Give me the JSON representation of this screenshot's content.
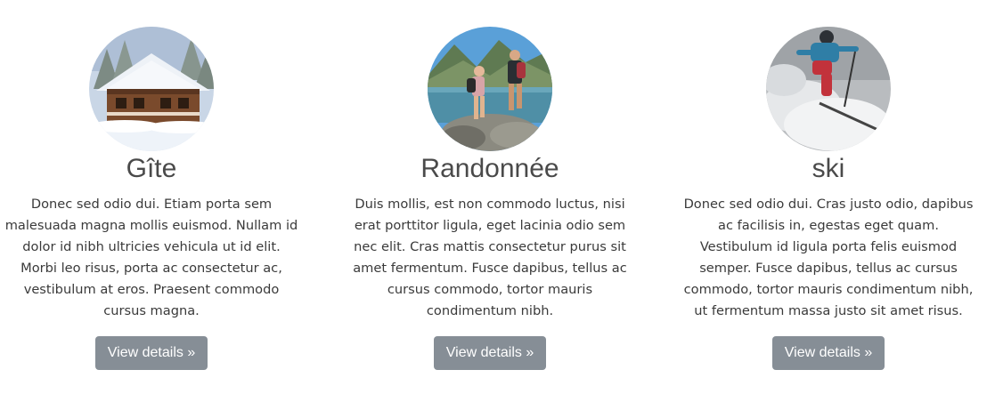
{
  "cards": [
    {
      "title": "Gîte",
      "image": "chalet-in-snow-photo",
      "text": "Donec sed odio dui. Etiam porta sem malesuada magna mollis euismod. Nullam id dolor id nibh ultricies vehicula ut id elit. Morbi leo risus, porta ac consectetur ac, vestibulum at eros. Praesent commodo cursus magna.",
      "button": "View details »"
    },
    {
      "title": "Randonnée",
      "image": "hikers-by-mountain-lake-photo",
      "text": "Duis mollis, est non commodo luctus, nisi erat porttitor ligula, eget lacinia odio sem nec elit. Cras mattis consectetur purus sit amet fermentum. Fusce dapibus, tellus ac cursus commodo, tortor mauris condimentum nibh.",
      "button": "View details »"
    },
    {
      "title": "ski",
      "image": "skier-in-powder-snow-photo",
      "text": "Donec sed odio dui. Cras justo odio, dapibus ac facilisis in, egestas eget quam. Vestibulum id ligula porta felis euismod semper. Fusce dapibus, tellus ac cursus commodo, tortor mauris condimentum nibh, ut fermentum massa justo sit amet risus.",
      "button": "View details »"
    }
  ],
  "colors": {
    "button_bg": "#868e96",
    "button_text": "#ffffff",
    "heading": "#4a4a4a",
    "body_text": "#3a3a3a"
  }
}
